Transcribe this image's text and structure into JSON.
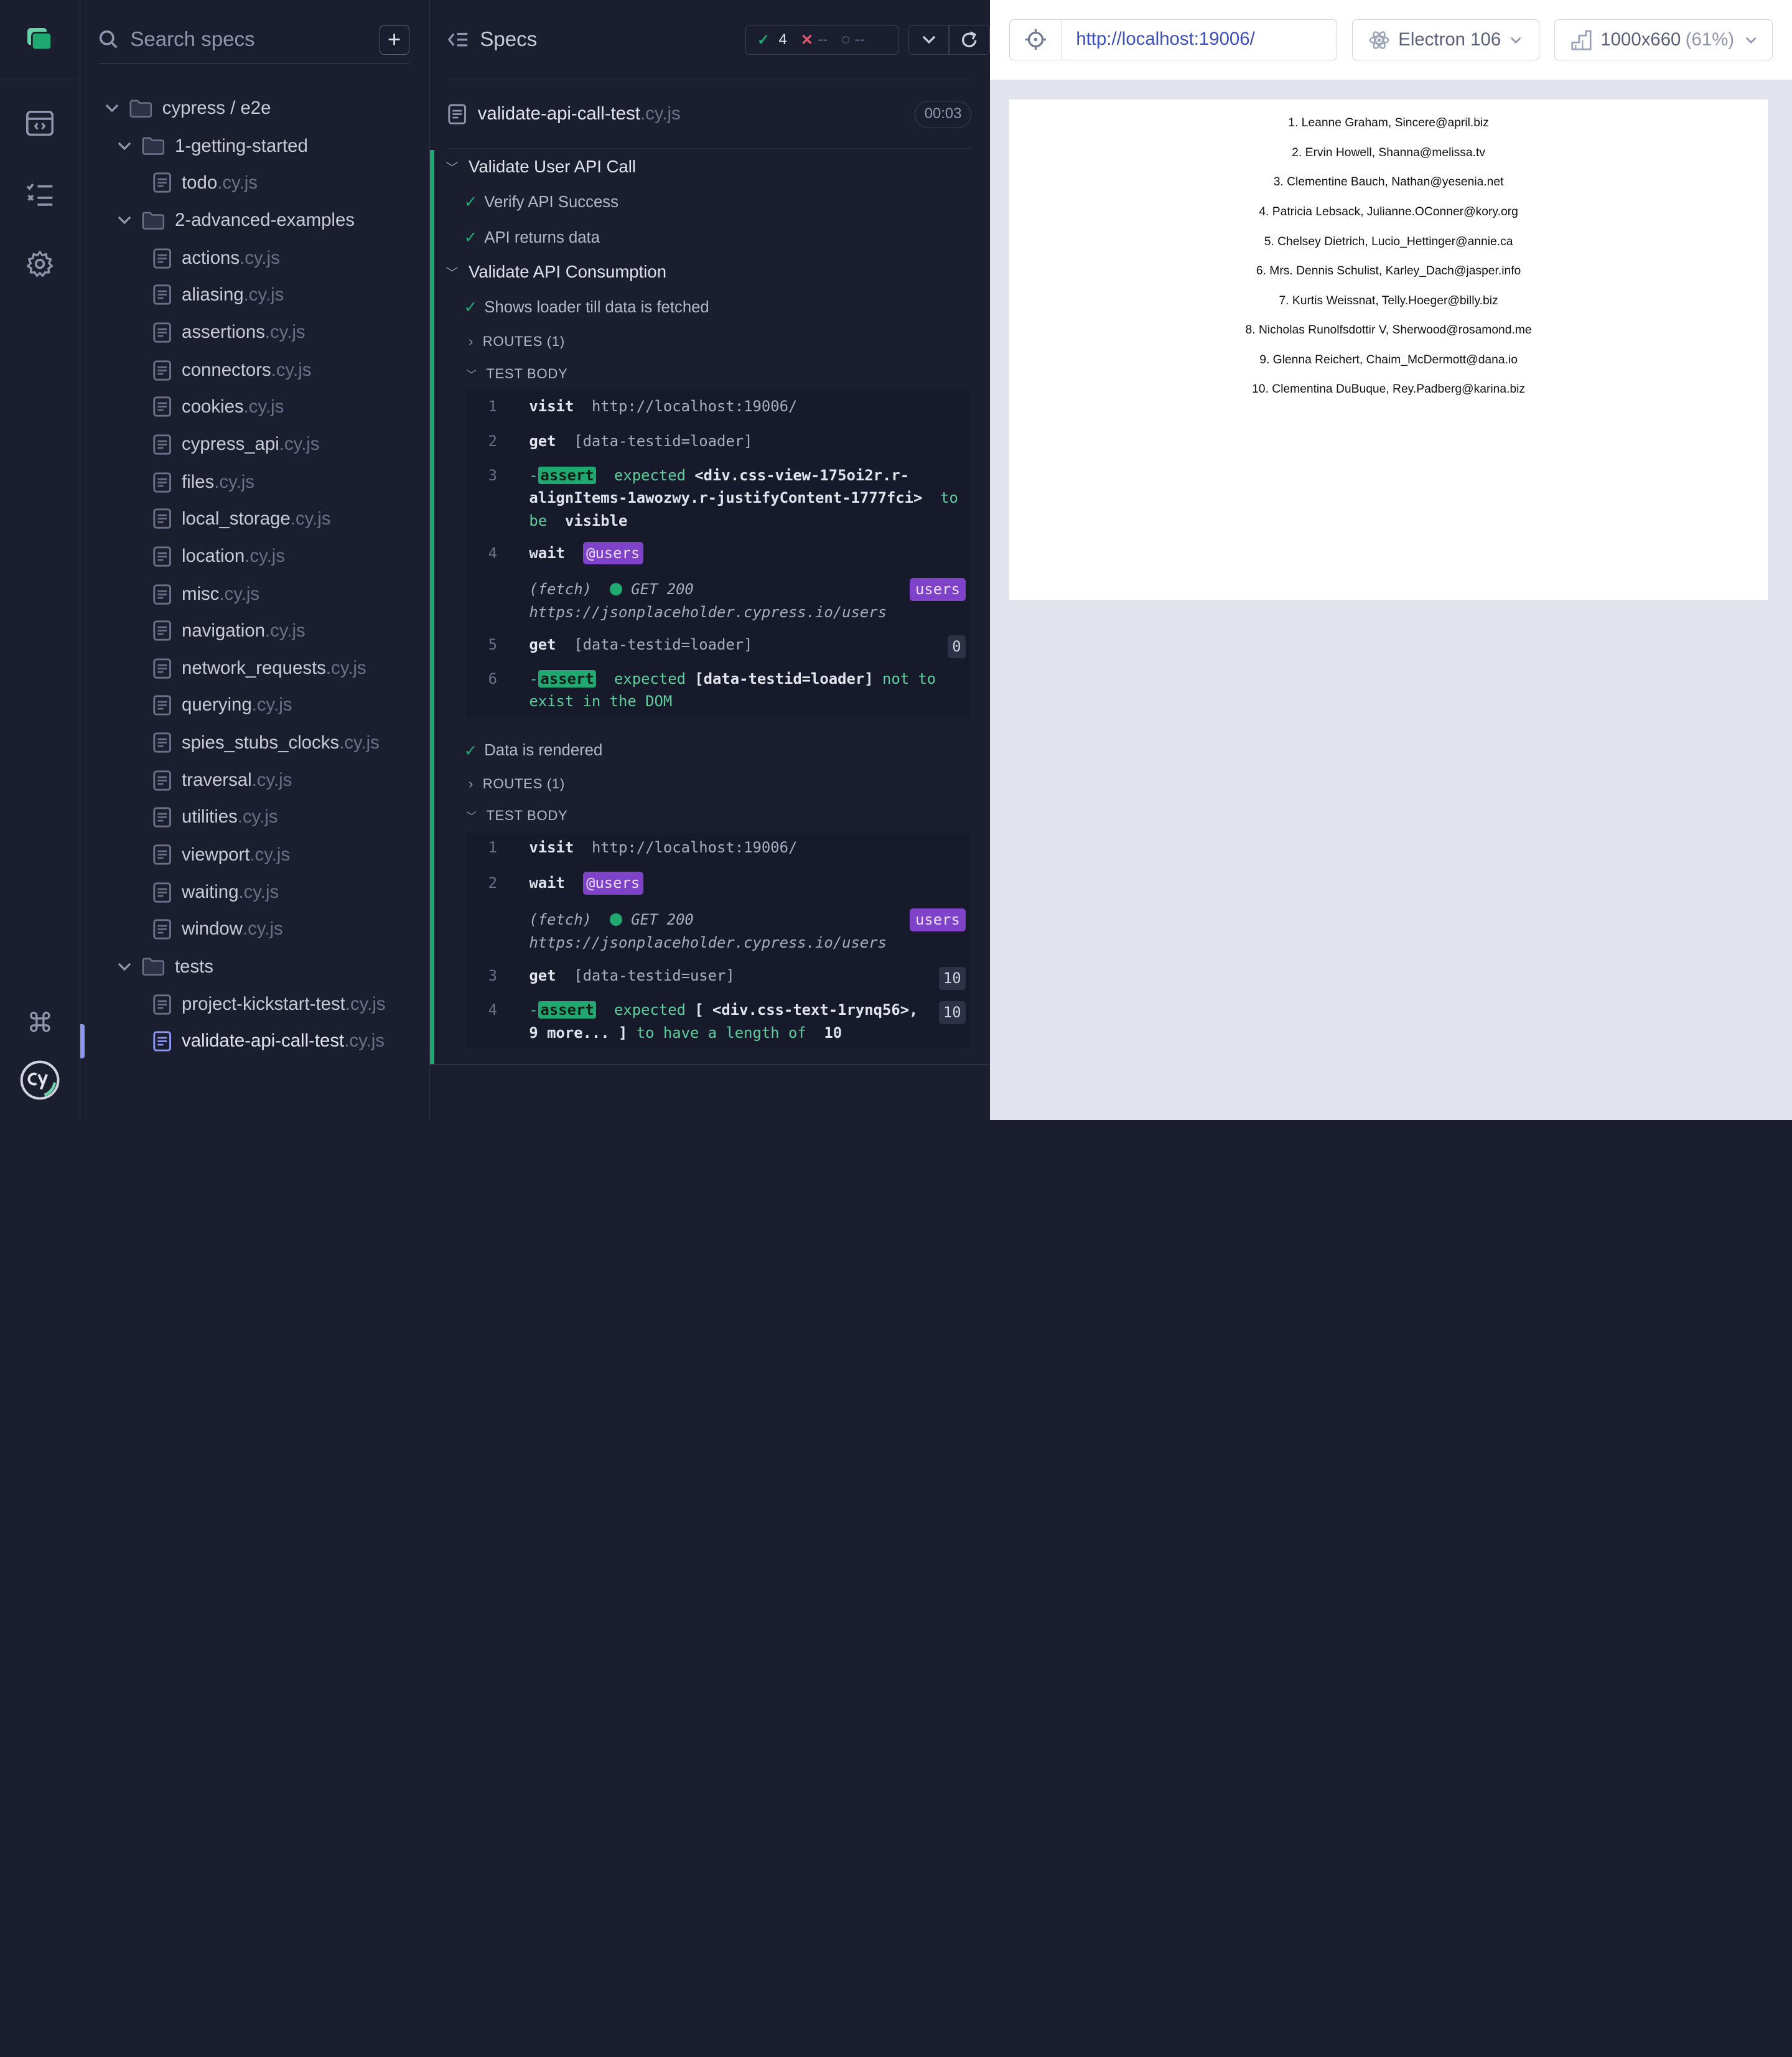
{
  "nav": {
    "items": [
      "specs",
      "runs",
      "settings"
    ],
    "bottom": [
      "keyboard-shortcuts",
      "cypress-logo"
    ]
  },
  "specs_list": {
    "search_placeholder": "Search specs",
    "add_label": "+",
    "root_folder": "cypress / e2e",
    "folders": {
      "f1": "1-getting-started",
      "f2": "2-advanced-examples",
      "f3": "tests"
    },
    "files": [
      {
        "name": "todo",
        "ext": ".cy.js"
      },
      {
        "name": "actions",
        "ext": ".cy.js"
      },
      {
        "name": "aliasing",
        "ext": ".cy.js"
      },
      {
        "name": "assertions",
        "ext": ".cy.js"
      },
      {
        "name": "connectors",
        "ext": ".cy.js"
      },
      {
        "name": "cookies",
        "ext": ".cy.js"
      },
      {
        "name": "cypress_api",
        "ext": ".cy.js"
      },
      {
        "name": "files",
        "ext": ".cy.js"
      },
      {
        "name": "local_storage",
        "ext": ".cy.js"
      },
      {
        "name": "location",
        "ext": ".cy.js"
      },
      {
        "name": "misc",
        "ext": ".cy.js"
      },
      {
        "name": "navigation",
        "ext": ".cy.js"
      },
      {
        "name": "network_requests",
        "ext": ".cy.js"
      },
      {
        "name": "querying",
        "ext": ".cy.js"
      },
      {
        "name": "spies_stubs_clocks",
        "ext": ".cy.js"
      },
      {
        "name": "traversal",
        "ext": ".cy.js"
      },
      {
        "name": "utilities",
        "ext": ".cy.js"
      },
      {
        "name": "viewport",
        "ext": ".cy.js"
      },
      {
        "name": "waiting",
        "ext": ".cy.js"
      },
      {
        "name": "window",
        "ext": ".cy.js"
      },
      {
        "name": "project-kickstart-test",
        "ext": ".cy.js"
      },
      {
        "name": "validate-api-call-test",
        "ext": ".cy.js"
      }
    ]
  },
  "reporter": {
    "title": "Specs",
    "stats": {
      "passed": "4",
      "failed": "--",
      "pending": "--"
    },
    "spec_name": "validate-api-call-test",
    "spec_ext": ".cy.js",
    "duration": "00:03",
    "suite1": "Validate User API Call",
    "t1": "Verify API Success",
    "t2": "API returns data",
    "suite2": "Validate API Consumption",
    "t3": "Shows loader till data is fetched",
    "routes": "ROUTES (1)",
    "test_body": "TEST BODY",
    "t4": "Data is rendered",
    "b1": {
      "n1": "1",
      "visit": "visit",
      "url": "http://localhost:19006/",
      "n2": "2",
      "get": "get",
      "sel_loader": "[data-testid=loader]",
      "n3": "3",
      "dash": "-",
      "assert": "assert",
      "expected": "expected",
      "el1": "<div.css-view-175oi2r.r-",
      "el2": "alignItems-1awozwy.r-justifyContent-1777fci>",
      "to": "to",
      "be": "be",
      "visible": "visible",
      "n4": "4",
      "wait": "wait",
      "alias": "@users",
      "fetch": "(fetch)",
      "status": "GET 200",
      "fetch_url": "https://jsonplaceholder.cypress.io/users",
      "users": "users",
      "n5": "5",
      "count0": "0",
      "n6": "6",
      "notto": "not to",
      "exist": "exist in the DOM"
    },
    "b2": {
      "n1": "1",
      "n2": "2",
      "n3": "3",
      "n4": "4",
      "sel_user": "[data-testid=user]",
      "count10": "10",
      "exp1": "[ <div.css-text-1rynq56>,",
      "exp2a": "9 more... ]",
      "exp2b": "to have a length of",
      "exp2c": "10"
    }
  },
  "aut": {
    "url": "http://localhost:19006/",
    "browser": "Electron 106",
    "viewport": "1000x660",
    "scale": "(61%)",
    "users": [
      "1. Leanne Graham, Sincere@april.biz",
      "2. Ervin Howell, Shanna@melissa.tv",
      "3. Clementine Bauch, Nathan@yesenia.net",
      "4. Patricia Lebsack, Julianne.OConner@kory.org",
      "5. Chelsey Dietrich, Lucio_Hettinger@annie.ca",
      "6. Mrs. Dennis Schulist, Karley_Dach@jasper.info",
      "7. Kurtis Weissnat, Telly.Hoeger@billy.biz",
      "8. Nicholas Runolfsdottir V, Sherwood@rosamond.me",
      "9. Glenna Reichert, Chaim_McDermott@dana.io",
      "10. Clementina DuBuque, Rey.Padberg@karina.biz"
    ]
  },
  "colors": {
    "bg": "#1b1e2e",
    "pass": "#1fa971",
    "alias": "#7f43c9",
    "link": "#3b4fc2"
  }
}
